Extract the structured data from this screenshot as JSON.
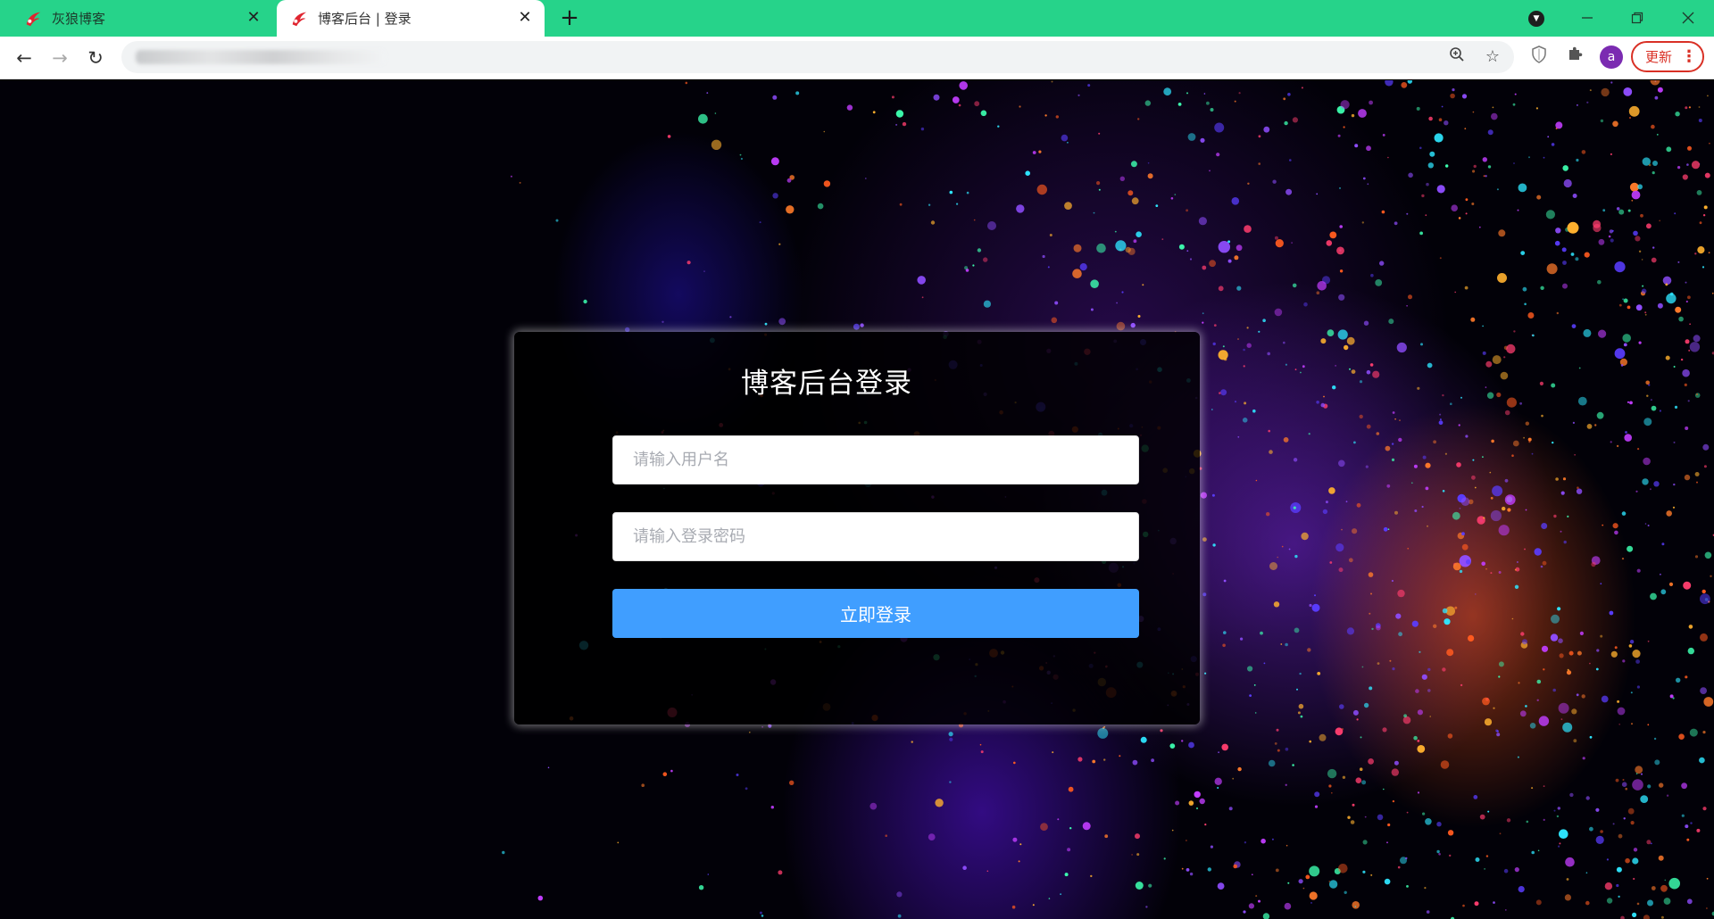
{
  "browser": {
    "tabs": [
      {
        "title": "灰狼博客",
        "active": false,
        "icon": "wolf-logo-icon"
      },
      {
        "title": "博客后台 | 登录",
        "active": true,
        "icon": "wolf-logo-icon"
      }
    ],
    "new_tab_icon": "plus-icon",
    "nav": {
      "back_icon": "back-arrow-icon",
      "forward_icon": "forward-arrow-icon",
      "reload_icon": "reload-icon"
    },
    "update_label": "更新",
    "avatar_letter": "a"
  },
  "login": {
    "title": "博客后台登录",
    "username_placeholder": "请输入用户名",
    "password_placeholder": "请输入登录密码",
    "submit_label": "立即登录"
  },
  "colors": {
    "tabbar": "#26d38a",
    "primary_button": "#409eff",
    "update_accent": "#d93025",
    "avatar": "#7b2bb1"
  }
}
